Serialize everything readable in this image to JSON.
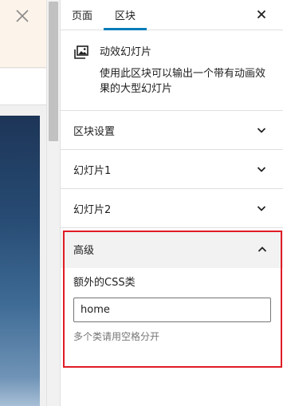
{
  "tabs": {
    "page_label": "页面",
    "block_label": "区块"
  },
  "block": {
    "title": "动效幻灯片",
    "description": "使用此区块可以输出一个带有动画效果的大型幻灯片"
  },
  "panels": [
    {
      "label": "区块设置"
    },
    {
      "label": "幻灯片1"
    },
    {
      "label": "幻灯片2"
    }
  ],
  "advanced": {
    "title": "高级",
    "css_label": "额外的CSS类",
    "css_value": "home",
    "css_help": "多个类请用空格分开"
  },
  "colors": {
    "accent": "#007cba",
    "highlight_outline": "#e01b24",
    "notice_background": "#fcf3ea"
  }
}
